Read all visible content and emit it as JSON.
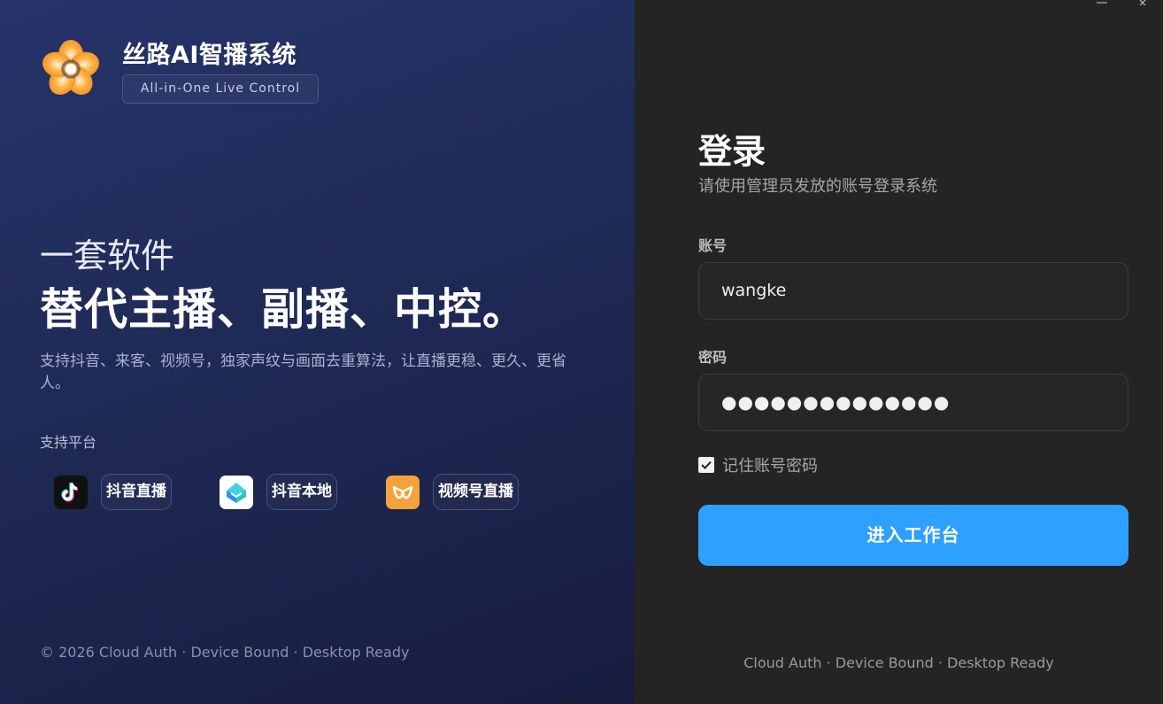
{
  "brand": {
    "title": "丝路AI智播系统",
    "tagline": "All-in-One Live Control"
  },
  "hero": {
    "line1": "一套软件",
    "line2": "替代主播、副播、中控。",
    "description": "支持抖音、来客、视频号，独家声纹与画面去重算法，让直播更稳、更久、更省人。"
  },
  "platforms": {
    "title": "支持平台",
    "items": [
      {
        "label": "抖音直播",
        "icon": "douyin-icon"
      },
      {
        "label": "抖音本地",
        "icon": "douyin-local-icon"
      },
      {
        "label": "视频号直播",
        "icon": "channels-icon"
      }
    ]
  },
  "left_footer": "© 2026  Cloud Auth · Device Bound · Desktop Ready",
  "login": {
    "title": "登录",
    "subtitle": "请使用管理员发放的账号登录系统",
    "account_label": "账号",
    "account_value": "wangke",
    "password_label": "密码",
    "password_mask": "●●●●●●●●●●●●●●",
    "remember_label": "记住账号密码",
    "remember_checked": true,
    "submit_label": "进入工作台"
  },
  "right_footer": "Cloud Auth · Device Bound · Desktop Ready",
  "colors": {
    "accent": "#2ea0ff",
    "left_bg": "#1f2a56",
    "right_bg": "#242424"
  }
}
